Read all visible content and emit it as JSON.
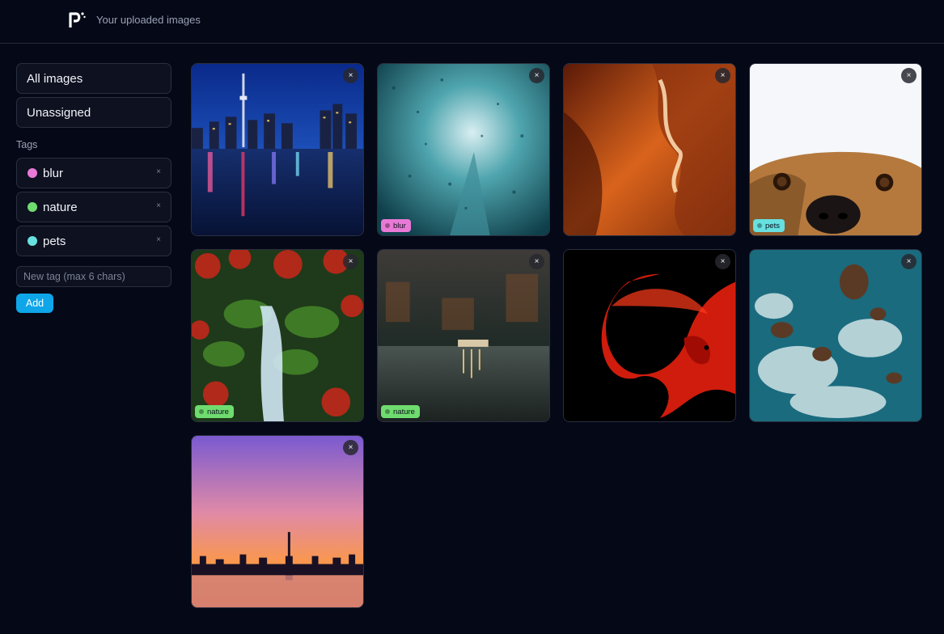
{
  "header": {
    "title": "Your uploaded images"
  },
  "sidebar": {
    "nav": [
      {
        "label": "All images"
      },
      {
        "label": "Unassigned"
      }
    ],
    "tags_heading": "Tags",
    "tags": [
      {
        "label": "blur",
        "color": "#e879d6"
      },
      {
        "label": "nature",
        "color": "#6fdc6f"
      },
      {
        "label": "pets",
        "color": "#67e0e0"
      }
    ],
    "tag_remove_symbol": "×",
    "new_tag_placeholder": "New tag (max 6 chars)",
    "add_label": "Add"
  },
  "images": [
    {
      "subject": "city-skyline-night",
      "tag": ""
    },
    {
      "subject": "rainy-window-street",
      "tag": "blur"
    },
    {
      "subject": "canyon-rock",
      "tag": ""
    },
    {
      "subject": "dog-peeking",
      "tag": "pets"
    },
    {
      "subject": "waterfall-autumn",
      "tag": "nature"
    },
    {
      "subject": "lake-forest",
      "tag": "nature"
    },
    {
      "subject": "red-betta-fish",
      "tag": ""
    },
    {
      "subject": "ocean-rocks-aerial",
      "tag": ""
    },
    {
      "subject": "sunset-skyline",
      "tag": ""
    }
  ],
  "close_symbol": "×",
  "colors": {
    "background": "#050816",
    "accent": "#0ea5e9"
  }
}
